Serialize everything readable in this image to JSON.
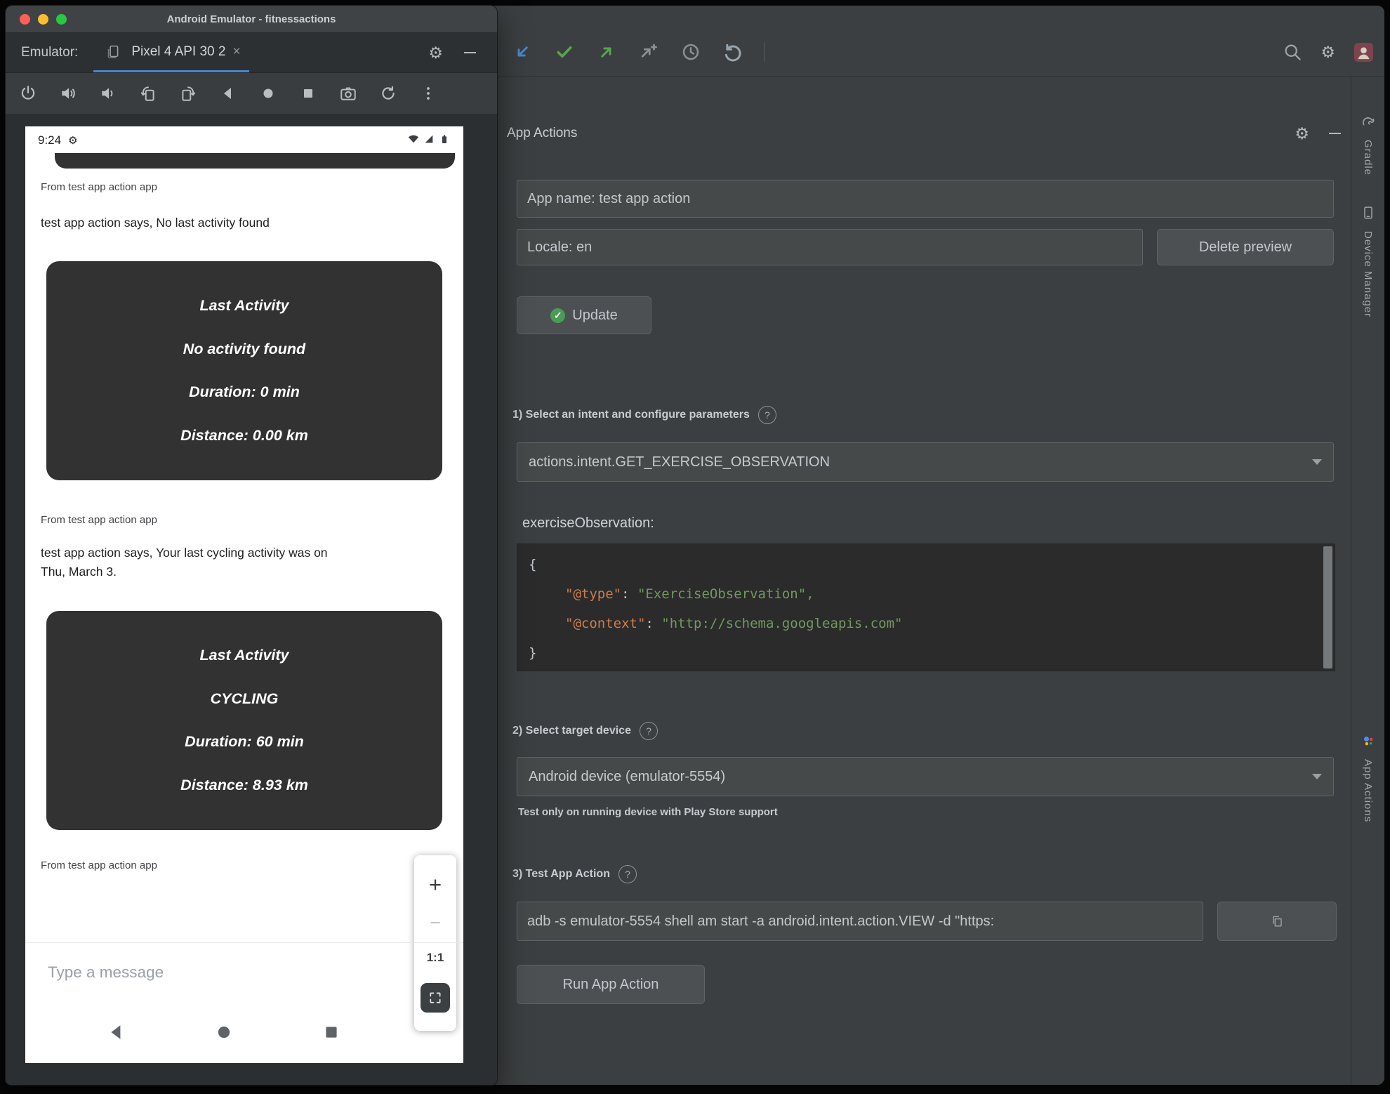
{
  "colors": {
    "accent_blue": "#4a88c7",
    "success_green": "#499c54",
    "code_key_orange": "#cb7d4e",
    "code_string_green": "#6f9a5e",
    "traffic_red": "#ff5f57",
    "traffic_yellow": "#febc2e",
    "traffic_green": "#28c840"
  },
  "emulator": {
    "titlebar": {
      "title": "Android Emulator - fitnessactions"
    },
    "tabs": {
      "label": "Emulator:",
      "tab": "Pixel 4 API 30 2",
      "close": "×"
    },
    "phone": {
      "status_time": "9:24",
      "messages": [
        {
          "from": "From test app action app",
          "text": "test app action says, No last activity found",
          "card": {
            "title": "Last Activity",
            "lines": [
              "No activity found",
              "Duration: 0 min",
              "Distance: 0.00 km"
            ]
          }
        },
        {
          "from": "From test app action app",
          "text": "test app action says, Your last cycling activity was on Thu, March 3.",
          "card": {
            "title": "Last Activity",
            "lines": [
              "CYCLING",
              "Duration: 60 min",
              "Distance: 8.93 km"
            ]
          }
        },
        {
          "from": "From test app action app"
        }
      ],
      "zoom": {
        "plus": "+",
        "minus": "−",
        "ratio": "1:1"
      },
      "input_placeholder": "Type a message"
    }
  },
  "studio": {
    "panel": {
      "title": "App Actions"
    },
    "fields": {
      "app_name": "App name: test app action",
      "locale": "Locale: en",
      "adb_command": "adb -s emulator-5554 shell am start -a android.intent.action.VIEW -d \"https:"
    },
    "buttons": {
      "delete_preview": "Delete preview",
      "update": "Update",
      "run": "Run App Action"
    },
    "sections": {
      "one": "1) Select an intent and configure parameters",
      "two": "2) Select target device",
      "three": "3) Test App Action"
    },
    "intent_dropdown": "actions.intent.GET_EXERCISE_OBSERVATION",
    "exercise_label": "exerciseObservation:",
    "code": {
      "open_brace": "{",
      "type_key": "\"@type\"",
      "colon": ": ",
      "type_value": "\"ExerciseObservation\",",
      "context_key": "\"@context\"",
      "context_value": "\"http://schema.googleapis.com\"",
      "close_brace": "}"
    },
    "device_dropdown": "Android device (emulator-5554)",
    "device_note": "Test only on running device with Play Store support",
    "right_tabs": {
      "gradle": "Gradle",
      "device_manager": "Device Manager",
      "app_actions": "App Actions"
    }
  }
}
